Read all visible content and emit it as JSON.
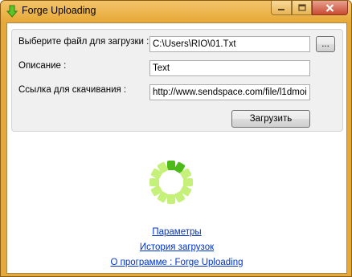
{
  "window": {
    "title": "Forge Uploading"
  },
  "form": {
    "file_label": "Выберите файл для загрузки :",
    "file_value": "C:\\Users\\RIO\\01.Txt",
    "browse_label": "...",
    "description_label": "Описание :",
    "description_value": "Text",
    "link_label": "Ссылка для скачивания :",
    "link_value": "http://www.sendspace.com/file/l1dmoi",
    "upload_label": "Загрузить"
  },
  "links": {
    "settings": "Параметры",
    "history": "История загрузок",
    "about": "О программе : Forge Uploading"
  },
  "colors": {
    "frame": "#e5a83a",
    "spinner_active": "#4cbb17",
    "spinner_inactive": "#c5f07a",
    "link": "#0033cc"
  },
  "icons": {
    "app": "green-down-arrow-icon",
    "minimize": "minimize-icon",
    "maximize": "maximize-icon",
    "close": "close-icon",
    "loading": "loading-spinner-icon"
  }
}
